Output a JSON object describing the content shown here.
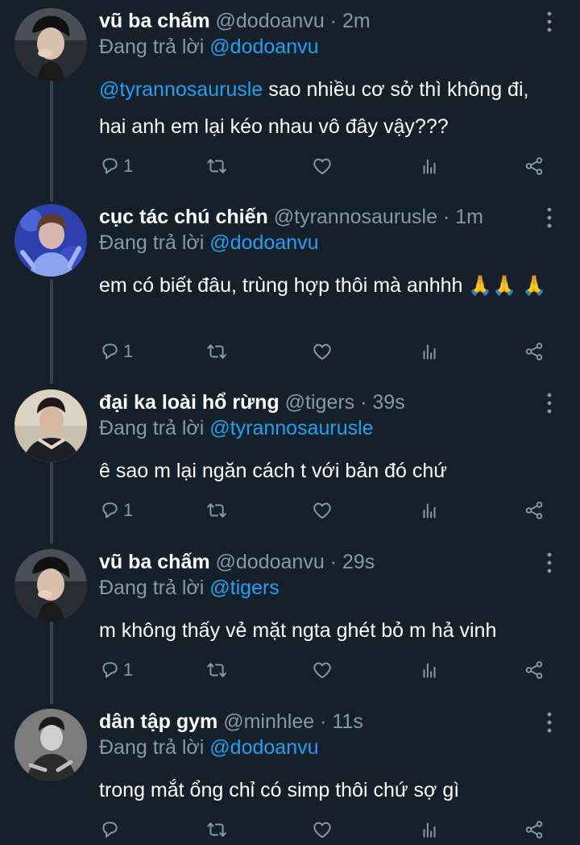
{
  "replying_prefix": "Đang trả lời",
  "tweets": [
    {
      "name": "vũ ba chấm",
      "handle": "@dodoanvu",
      "time": "· 2m",
      "reply_to": "@dodoanvu",
      "mention": "@tyrannosaurusle",
      "text": " sao nhiều cơ sở thì không đi, hai anh em lại kéo nhau vô đây vậy???",
      "reply_count": "1"
    },
    {
      "name": "cục tác chú chiến",
      "handle": "@tyrannosaurusle",
      "time": "· 1m",
      "reply_to": "@dodoanvu",
      "text": "em có biết đâu, trùng hợp thôi mà anhhh ",
      "emoji": "🙏",
      "reply_count": "1"
    },
    {
      "name": "đại ka loài hổ rừng",
      "handle": "@tigers",
      "time": "· 39s",
      "reply_to": "@tyrannosaurusle",
      "text": "ê sao m lại ngăn cách t với bản đó chứ",
      "reply_count": "1"
    },
    {
      "name": "vũ ba chấm",
      "handle": "@dodoanvu",
      "time": "· 29s",
      "reply_to": "@tigers",
      "text": "m không thấy vẻ mặt ngta ghét bỏ m hả vinh",
      "reply_count": "1"
    },
    {
      "name": "dân tập gym",
      "handle": "@minhlee",
      "time": "· 11s",
      "reply_to": "@dodoanvu",
      "text": "trong mắt ổng chỉ có simp thôi chứ sợ gì",
      "reply_count": ""
    }
  ],
  "colors": {
    "background": "#15202b",
    "text": "#ffffff",
    "muted": "#8899a6",
    "mention": "#1da1f2",
    "thread_line": "#38444d"
  },
  "icons": [
    "reply-icon",
    "retweet-icon",
    "like-icon",
    "analytics-icon",
    "share-icon",
    "more-options-icon"
  ]
}
